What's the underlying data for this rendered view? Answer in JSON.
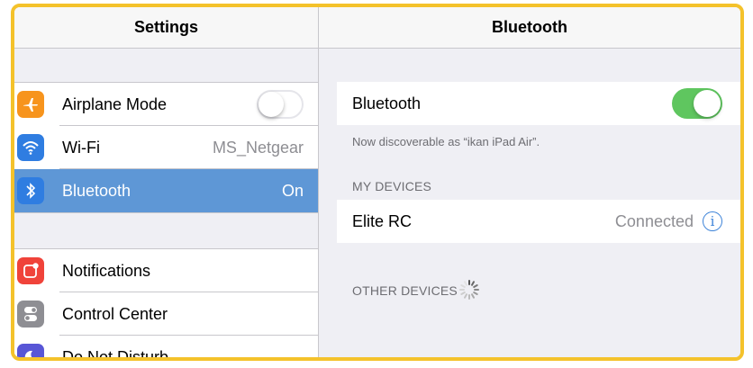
{
  "settings_pane": {
    "title": "Settings",
    "group1": [
      {
        "label": "Airplane Mode",
        "value": "",
        "icon": "airplane-icon",
        "color": "#f7941d",
        "toggle": false
      },
      {
        "label": "Wi-Fi",
        "value": "MS_Netgear",
        "icon": "wifi-icon",
        "color": "#2f7de1"
      },
      {
        "label": "Bluetooth",
        "value": "On",
        "icon": "bluetooth-icon",
        "color": "#2f7de1",
        "selected": true
      }
    ],
    "group2": [
      {
        "label": "Notifications",
        "icon": "notifications-icon",
        "color": "#f0433a"
      },
      {
        "label": "Control Center",
        "icon": "control-center-icon",
        "color": "#8e8e93"
      },
      {
        "label": "Do Not Disturb",
        "icon": "moon-icon",
        "color": "#5856d6"
      }
    ]
  },
  "bluetooth_pane": {
    "title": "Bluetooth",
    "toggle_label": "Bluetooth",
    "toggle_on": true,
    "discoverable_note": "Now discoverable as “ikan iPad Air”.",
    "my_devices_header": "MY DEVICES",
    "devices": [
      {
        "name": "Elite RC",
        "status": "Connected"
      }
    ],
    "other_devices_header": "OTHER DEVICES"
  },
  "colors": {
    "accent": "#5e97d6",
    "toggle_on": "#5fc65f",
    "frame": "#f4c22b",
    "info": "#3b82d8"
  }
}
